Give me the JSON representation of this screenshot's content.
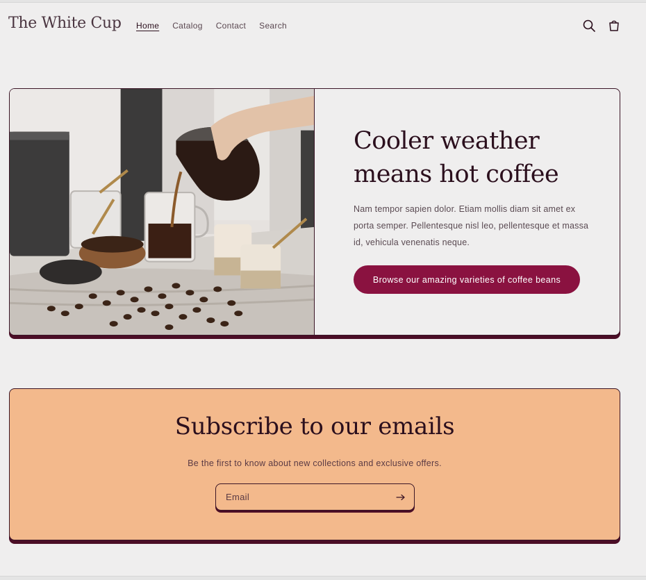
{
  "header": {
    "logo": "The White Cup",
    "nav": [
      {
        "label": "Home",
        "active": true
      },
      {
        "label": "Catalog",
        "active": false
      },
      {
        "label": "Contact",
        "active": false
      },
      {
        "label": "Search",
        "active": false
      }
    ],
    "icons": [
      "search-icon",
      "cart-icon"
    ]
  },
  "hero": {
    "image": "coffee-pour-photo",
    "heading": "Cooler weather means hot coffee",
    "body": "Nam tempor sapien dolor. Etiam mollis diam sit amet ex porta semper. Pellentesque nisl leo, pellentesque et massa id, vehicula venenatis neque.",
    "cta_label": "Browse our amazing varieties of coffee beans"
  },
  "newsletter": {
    "heading": "Subscribe to our emails",
    "subtext": "Be the first to know about new collections and exclusive offers.",
    "email_placeholder": "Email",
    "submit_icon": "arrow-right-icon"
  },
  "colors": {
    "background": "#efeeee",
    "accent": "#8a1240",
    "text": "#2b0f1d",
    "newsletter_bg": "#f3b98c",
    "shadow": "#4b0d26"
  }
}
